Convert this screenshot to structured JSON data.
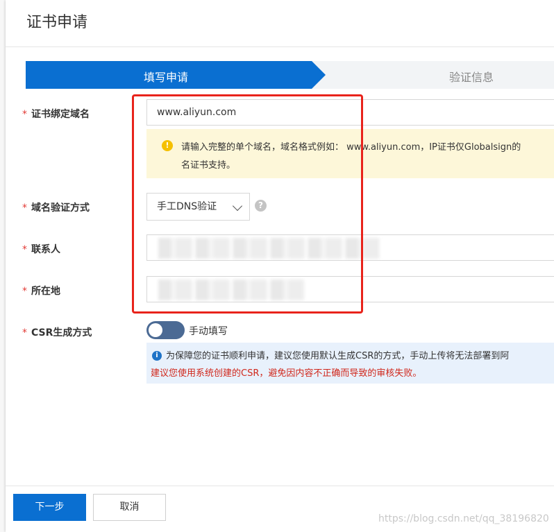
{
  "dialog": {
    "title": "证书申请"
  },
  "steps": [
    {
      "label": "填写申请",
      "active": true
    },
    {
      "label": "验证信息",
      "active": false
    }
  ],
  "form": {
    "domain": {
      "label": "证书绑定域名",
      "value": "www.aliyun.com"
    },
    "warning": {
      "line1": "请输入完整的单个域名，域名格式例如： www.aliyun.com，IP证书仅Globalsign的",
      "line2": "名证书支持。"
    },
    "verify_method": {
      "label": "域名验证方式",
      "selected": "手工DNS验证"
    },
    "contact": {
      "label": "联系人"
    },
    "location": {
      "label": "所在地"
    },
    "csr": {
      "label": "CSR生成方式",
      "toggle_label": "手动填写",
      "info_line1": "为保障您的证书顺利申请，建议您使用默认生成CSR的方式，手动上传将无法部署到阿",
      "info_line2": "建议您使用系统创建的CSR，避免因内容不正确而导致的审核失败。"
    },
    "required_mark": "*"
  },
  "footer": {
    "next_label": "下一步",
    "cancel_label": "取消"
  },
  "watermark": "https://blog.csdn.net/qq_38196820",
  "colors": {
    "primary": "#0a6fd1",
    "required": "#e23b36",
    "highlight_box": "#e8231b"
  }
}
